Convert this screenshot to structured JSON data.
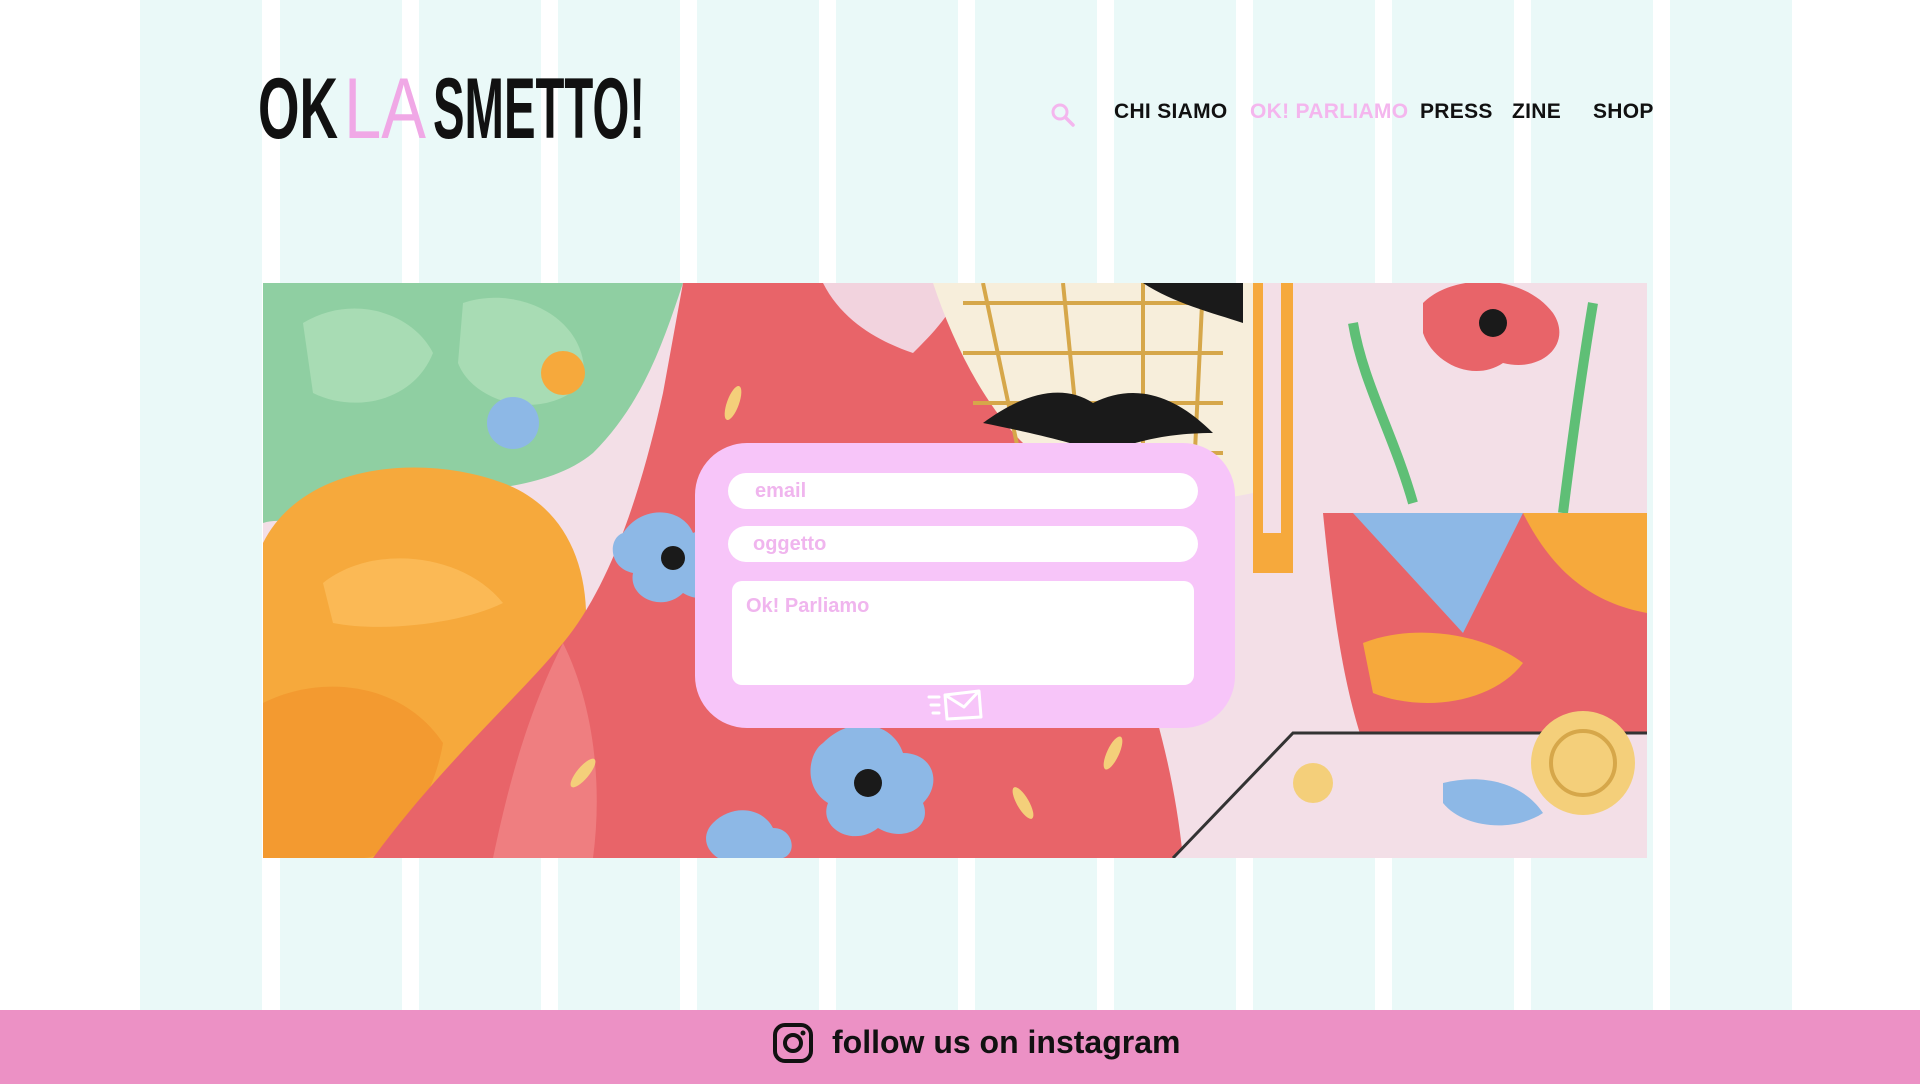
{
  "brand": {
    "logo_text_start": "OK",
    "logo_text_mid": "LA",
    "logo_text_end": "SMETTO!",
    "colors": {
      "black": "#111111",
      "pink": "#f0a8e6"
    }
  },
  "nav": {
    "search_icon": "search-icon",
    "items": [
      {
        "label": "CHI SIAMO",
        "active": false
      },
      {
        "label": "OK! PARLIAMO",
        "active": true
      },
      {
        "label": "PRESS",
        "active": false
      },
      {
        "label": "ZINE",
        "active": false
      },
      {
        "label": "SHOP",
        "active": false
      }
    ]
  },
  "contact_form": {
    "email_placeholder": "email",
    "subject_placeholder": "oggetto",
    "message_placeholder": "Ok! Parliamo",
    "send_icon": "send-mail-icon",
    "colors": {
      "card": "#f7c5f9",
      "placeholder": "#f0b5ee"
    }
  },
  "footer": {
    "icon": "instagram-icon",
    "link_label": "follow us on instagram",
    "background": "#ec91c5"
  },
  "colors": {
    "stripe": "#eaf9f8",
    "accent_pink": "#f4b6ee"
  }
}
